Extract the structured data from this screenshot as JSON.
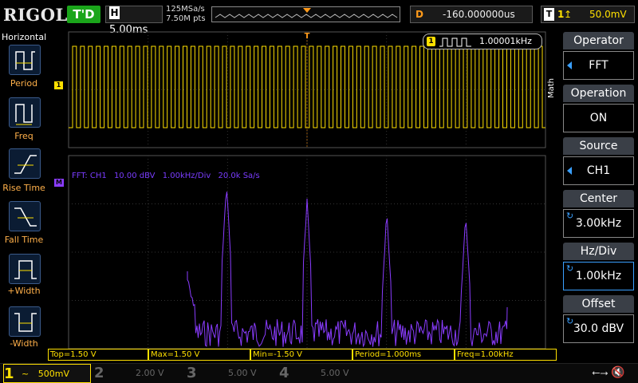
{
  "brand": "RIGOL",
  "top": {
    "trigger_status": "T'D",
    "timebase_letter": "H",
    "timebase": "5.00ms",
    "sample_rate": "125MSa/s",
    "memory_points": "7.50M pts",
    "delay_letter": "D",
    "delay": "-160.000000us",
    "trigger_letter": "T",
    "trigger_source": "1",
    "trigger_level": "50.0mV"
  },
  "left_panel": {
    "title": "Horizontal",
    "items": [
      {
        "label": "Period",
        "icon": "period-icon"
      },
      {
        "label": "Freq",
        "icon": "freq-icon"
      },
      {
        "label": "Rise Time",
        "icon": "rise-time-icon"
      },
      {
        "label": "Fall Time",
        "icon": "fall-time-icon"
      },
      {
        "label": "+Width",
        "icon": "positive-width-icon"
      },
      {
        "label": "-Width",
        "icon": "negative-width-icon"
      }
    ]
  },
  "screen": {
    "channel_marker": "1",
    "math_marker": "M",
    "trigger_marker": "T",
    "freq_counter_badge": "1",
    "freq_counter": "1.00001kHz",
    "fft_info": {
      "label": "FFT: CH1",
      "scale": "10.00 dBV",
      "hz_div": "1.00kHz/Div",
      "sample": "20.0k Sa/s"
    }
  },
  "measurements": {
    "top": "Top=1.50 V",
    "max": "Max=1.50 V",
    "min": "Min=-1.50 V",
    "period": "Period=1.000ms",
    "freq": "Freq=1.00kHz"
  },
  "right_panel": {
    "tab": "Math",
    "items": [
      {
        "title": "Operator",
        "value": "FFT"
      },
      {
        "title": "Operation",
        "value": "ON"
      },
      {
        "title": "Source",
        "value": "CH1"
      },
      {
        "title": "Center",
        "value": "3.00kHz"
      },
      {
        "title": "Hz/Div",
        "value": "1.00kHz"
      },
      {
        "title": "Offset",
        "value": "30.0 dBV"
      }
    ]
  },
  "channels": [
    {
      "num": "1",
      "coupling": "~",
      "scale": "500mV"
    },
    {
      "num": "2",
      "scale": "2.00 V"
    },
    {
      "num": "3",
      "scale": "5.00 V"
    },
    {
      "num": "4",
      "scale": "5.00 V"
    }
  ],
  "colors": {
    "ch1": "#ffe000",
    "math": "#8a3cff",
    "trigger": "#ff9a1a",
    "status_green": "#1aa51a"
  }
}
